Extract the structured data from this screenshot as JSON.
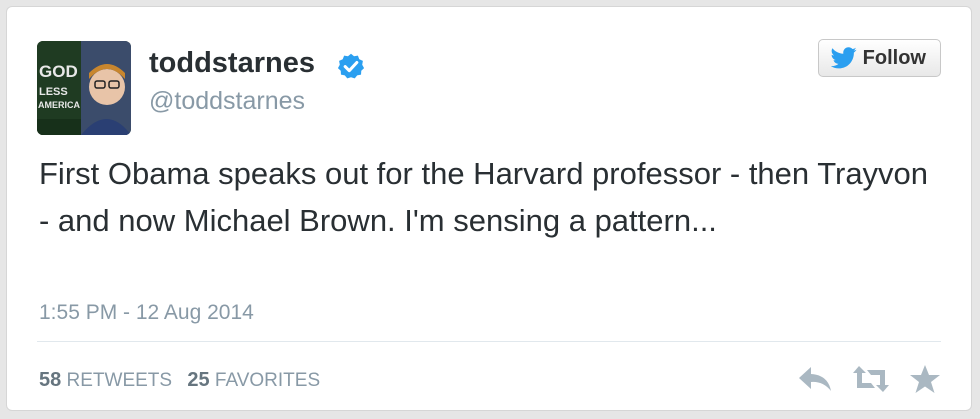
{
  "tweet": {
    "display_name": "toddstarnes",
    "handle": "@toddstarnes",
    "follow_label": "Follow",
    "text": "First Obama speaks out for the Harvard professor - then Trayvon - and now Michael Brown. I'm sensing a pattern...",
    "timestamp": "1:55 PM - 12 Aug 2014",
    "retweets_count": "58",
    "retweets_label": "RETWEETS",
    "favorites_count": "25",
    "favorites_label": "FAVORITES",
    "avatar_text": [
      "GOD",
      "LESS",
      "AMERICA"
    ]
  },
  "icons": {
    "verified": "verified-badge-icon",
    "bird": "twitter-bird-icon",
    "reply": "reply-icon",
    "retweet": "retweet-icon",
    "favorite": "star-icon"
  },
  "colors": {
    "verified_blue": "#2b9ff0",
    "bird_blue": "#2b9ff0",
    "text": "#292f33",
    "muted": "#8899a6",
    "action_icons": "#aab8c2"
  }
}
